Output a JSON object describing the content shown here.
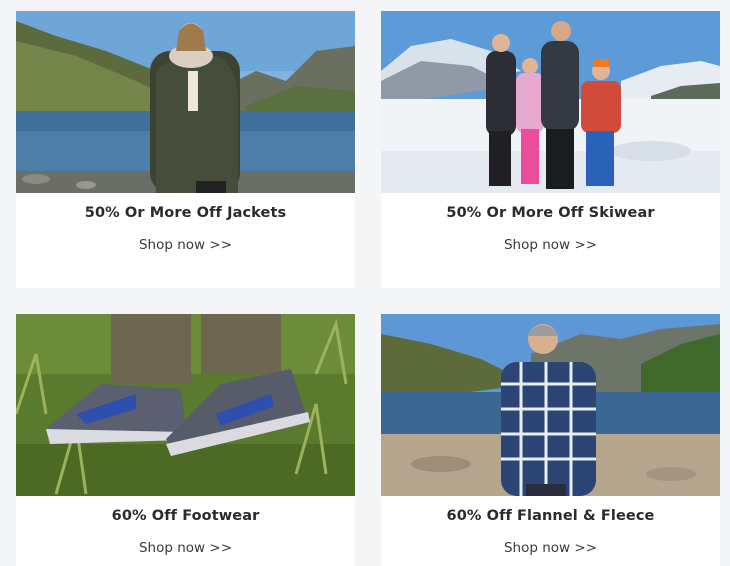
{
  "cards": [
    {
      "title": "50% Or More Off Jackets",
      "link": "Shop now >>",
      "image": "woman-in-puffer-jacket-by-lake"
    },
    {
      "title": "50% Or More Off Skiwear",
      "link": "Shop now >>",
      "image": "family-in-skiwear-on-snow"
    },
    {
      "title": "60% Off Footwear",
      "link": "Shop now >>",
      "image": "walking-boots-on-grass"
    },
    {
      "title": "60% Off Flannel & Fleece",
      "link": "Shop now >>",
      "image": "man-in-flannel-shirt-by-lake"
    }
  ]
}
